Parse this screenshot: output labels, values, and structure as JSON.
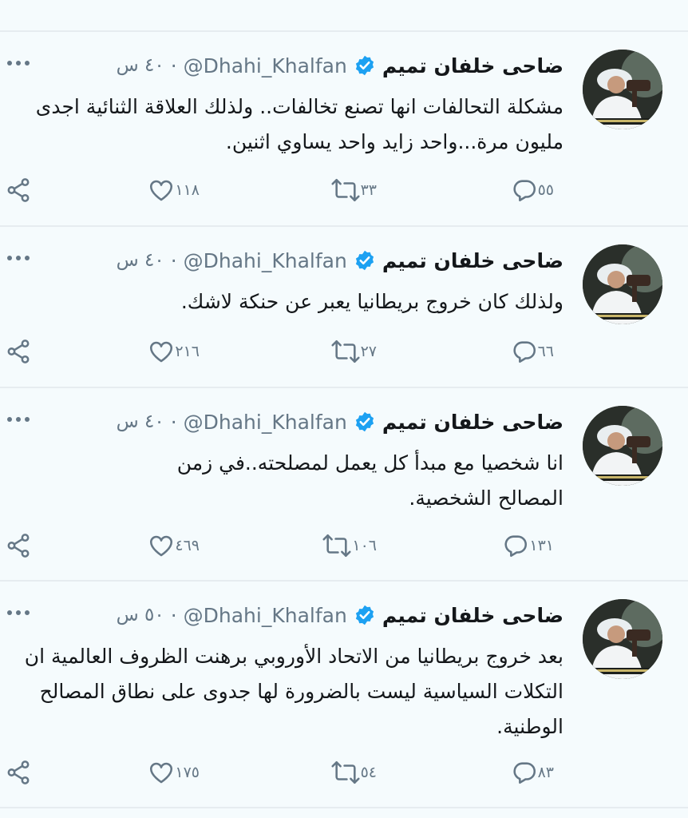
{
  "colors": {
    "background": "#f5fbfd",
    "text": "#14171a",
    "muted": "#657786",
    "verified": "#1da1f2",
    "divider": "#e6ecf0"
  },
  "icons": {
    "verified": "verified-badge-icon",
    "more": "more-icon",
    "reply": "reply-icon",
    "retweet": "retweet-icon",
    "like": "heart-icon",
    "share": "share-icon"
  },
  "tweets": [
    {
      "name": "ضاحى خلفان تميم",
      "handle": "@Dhahi_Khalfan",
      "time": "٤٠ س",
      "text": "مشكلة التحالفات انها تصنع تخالفات.. ولذلك العلاقة الثنائية اجدى مليون مرة...واحد زايد واحد يساوي اثنين.",
      "replies": "٥٥",
      "retweets": "٣٣",
      "likes": "١١٨"
    },
    {
      "name": "ضاحى خلفان تميم",
      "handle": "@Dhahi_Khalfan",
      "time": "٤٠ س",
      "text": "ولذلك كان خروج بريطانيا يعبر عن حنكة لاشك.",
      "replies": "٦٦",
      "retweets": "٢٧",
      "likes": "٢١٦"
    },
    {
      "name": "ضاحى خلفان تميم",
      "handle": "@Dhahi_Khalfan",
      "time": "٤٠ س",
      "text": "انا شخصيا مع مبدأ كل يعمل لمصلحته..في زمن المصالح الشخصية.",
      "replies": "١٣١",
      "retweets": "١٠٦",
      "likes": "٤٦٩"
    },
    {
      "name": "ضاحى خلفان تميم",
      "handle": "@Dhahi_Khalfan",
      "time": "٥٠ س",
      "text": "بعد خروج بريطانيا من الاتحاد الأوروبي برهنت الظروف العالمية ان التكلات السياسية ليست بالضرورة لها جدوى على نطاق المصالح الوطنية.",
      "replies": "٨٣",
      "retweets": "٥٤",
      "likes": "١٧٥"
    }
  ]
}
